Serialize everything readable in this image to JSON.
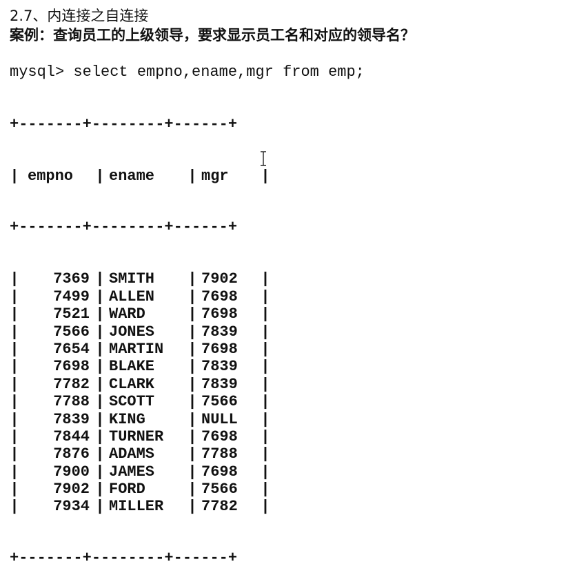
{
  "heading": {
    "line1": "2.7、内连接之自连接",
    "line2": "案例：查询员工的上级领导，要求显示员工名和对应的领导名？"
  },
  "query": "mysql> select empno,ename,mgr from emp;",
  "table": {
    "separator": "+-------+--------+------+",
    "columns": [
      "empno",
      "ename",
      "mgr"
    ],
    "rows": [
      [
        "7369",
        "SMITH",
        "7902"
      ],
      [
        "7499",
        "ALLEN",
        "7698"
      ],
      [
        "7521",
        "WARD",
        "7698"
      ],
      [
        "7566",
        "JONES",
        "7839"
      ],
      [
        "7654",
        "MARTIN",
        "7698"
      ],
      [
        "7698",
        "BLAKE",
        "7839"
      ],
      [
        "7782",
        "CLARK",
        "7839"
      ],
      [
        "7788",
        "SCOTT",
        "7566"
      ],
      [
        "7839",
        "KING",
        "NULL"
      ],
      [
        "7844",
        "TURNER",
        "7698"
      ],
      [
        "7876",
        "ADAMS",
        "7788"
      ],
      [
        "7900",
        "JAMES",
        "7698"
      ],
      [
        "7902",
        "FORD",
        "7566"
      ],
      [
        "7934",
        "MILLER",
        "7782"
      ]
    ]
  },
  "icons": {
    "cursor": "text-cursor-icon"
  }
}
